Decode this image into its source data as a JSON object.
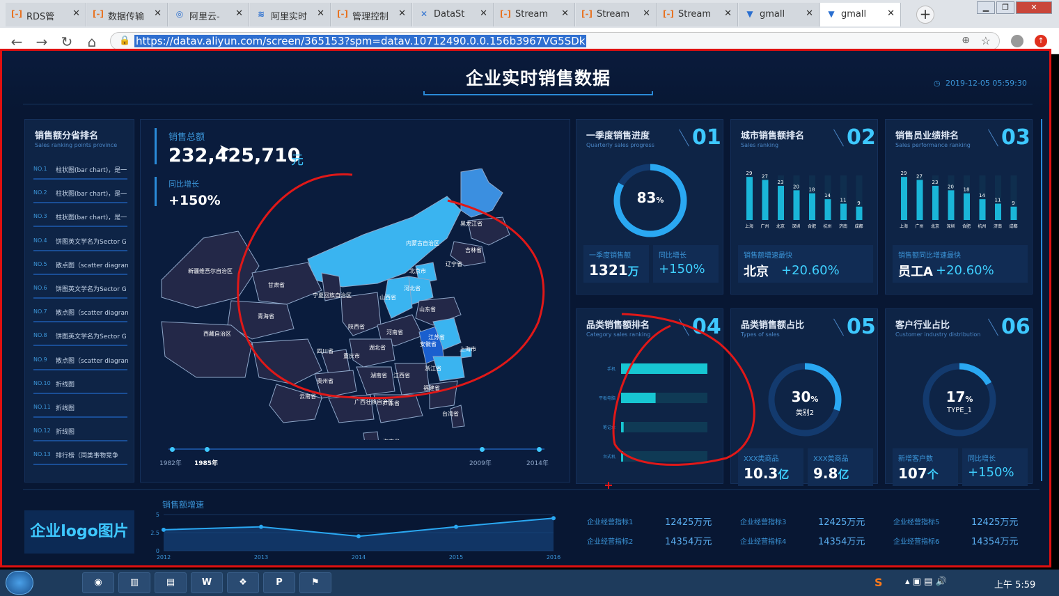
{
  "browser": {
    "tabs": [
      {
        "icon": "[-]",
        "label": "RDS管"
      },
      {
        "icon": "[-]",
        "label": "数据传输"
      },
      {
        "icon": "◎",
        "label": "阿里云-"
      },
      {
        "icon": "≋",
        "label": "阿里实时"
      },
      {
        "icon": "[-]",
        "label": "管理控制"
      },
      {
        "icon": "✕",
        "label": "DataSt"
      },
      {
        "icon": "[-]",
        "label": "Stream"
      },
      {
        "icon": "[-]",
        "label": "Stream"
      },
      {
        "icon": "[-]",
        "label": "Stream"
      },
      {
        "icon": "▼",
        "label": "gmall"
      },
      {
        "icon": "▼",
        "label": "gmall"
      }
    ],
    "url": "https://datav.aliyun.com/screen/365153?spm=datav.10712490.0.0.156b3967VG5SDk"
  },
  "dashboard": {
    "title": "企业实时销售数据",
    "timestamp": "2019-12-05 05:59:30",
    "left_panel": {
      "title": "销售额分省排名",
      "subtitle": "Sales ranking points province",
      "items": [
        {
          "no": "NO.1",
          "text": "柱状图(bar chart)，是一"
        },
        {
          "no": "NO.2",
          "text": "柱状图(bar chart)，是一"
        },
        {
          "no": "NO.3",
          "text": "柱状图(bar chart)，是一"
        },
        {
          "no": "NO.4",
          "text": "饼图英文学名为Sector G"
        },
        {
          "no": "NO.5",
          "text": "散点图（scatter diagran"
        },
        {
          "no": "NO.6",
          "text": "饼图英文学名为Sector G"
        },
        {
          "no": "NO.7",
          "text": "散点图（scatter diagran"
        },
        {
          "no": "NO.8",
          "text": "饼图英文学名为Sector G"
        },
        {
          "no": "NO.9",
          "text": "散点图（scatter diagran"
        },
        {
          "no": "NO.10",
          "text": "折线图"
        },
        {
          "no": "NO.11",
          "text": "折线图"
        },
        {
          "no": "NO.12",
          "text": "折线图"
        },
        {
          "no": "NO.13",
          "text": "排行榜（同类事物竞争"
        }
      ]
    },
    "map_panel": {
      "sales_label": "销售总额",
      "sales_value": "232,425,710",
      "sales_unit": "元",
      "growth_label": "同比增长",
      "growth_value": "+150%",
      "provinces": [
        "黑龙江省",
        "吉林省",
        "辽宁省",
        "内蒙古自治区",
        "北京市",
        "河北省",
        "山西省",
        "山东省",
        "新疆维吾尔自治区",
        "甘肃省",
        "青海省",
        "宁夏回族自治区",
        "陕西省",
        "河南省",
        "西藏自治区",
        "四川省",
        "重庆市",
        "湖北省",
        "安徽省",
        "江苏省",
        "上海市",
        "浙江省",
        "湖南省",
        "江西省",
        "福建省",
        "贵州省",
        "云南省",
        "广西壮族自治区",
        "广东省",
        "台湾省",
        "海南省"
      ],
      "timeline": [
        "1982年",
        "1985年",
        "2009年",
        "2014年"
      ]
    },
    "cards": [
      {
        "title": "一季度销售进度",
        "subtitle": "Quarterly sales progress",
        "num": "01",
        "gauge": "83",
        "gauge_unit": "%",
        "stat1_label": "一季度销售额",
        "stat1_value": "1321",
        "stat1_unit": "万",
        "stat2_label": "同比增长",
        "stat2_value": "+150%"
      },
      {
        "title": "城市销售额排名",
        "subtitle": "Sales ranking",
        "num": "02",
        "stat1_label": "销售额增速最快",
        "stat1_value": "北京",
        "stat2_value": "+20.60%"
      },
      {
        "title": "销售员业绩排名",
        "subtitle": "Sales performance ranking",
        "num": "03",
        "stat1_label": "销售额同比增速最快",
        "stat1_value": "员工A",
        "stat2_value": "+20.60%"
      },
      {
        "title": "品类销售额排名",
        "subtitle": "Category sales ranking",
        "num": "04"
      },
      {
        "title": "品类销售额占比",
        "subtitle": "Types of sales",
        "num": "05",
        "gauge": "30",
        "gauge_unit": "%",
        "gauge_label": "类别2",
        "stat1_label": "XXX类商品",
        "stat1_value": "10.3",
        "stat1_unit": "亿",
        "stat2_label": "XXX类商品",
        "stat2_value": "9.8",
        "stat2_unit": "亿"
      },
      {
        "title": "客户行业占比",
        "subtitle": "Customer industry distribution",
        "num": "06",
        "gauge": "17",
        "gauge_unit": "%",
        "gauge_label": "TYPE_1",
        "stat1_label": "新增客户数",
        "stat1_value": "107",
        "stat1_unit": "个",
        "stat2_label": "同比增长",
        "stat2_value": "+150%"
      }
    ],
    "logo_text": "企业logo图片",
    "growth_chart_title": "销售额增速",
    "metrics": [
      {
        "label": "企业经营指标1",
        "value": "12425万元"
      },
      {
        "label": "企业经营指标2",
        "value": "14354万元"
      },
      {
        "label": "企业经营指标3",
        "value": "12425万元"
      },
      {
        "label": "企业经营指标4",
        "value": "14354万元"
      },
      {
        "label": "企业经营指标5",
        "value": "12425万元"
      },
      {
        "label": "企业经营指标6",
        "value": "14354万元"
      }
    ]
  },
  "chart_data": [
    {
      "type": "bar",
      "categories": [
        "上海",
        "广州",
        "北京",
        "深圳",
        "合肥",
        "杭州",
        "济南",
        "成都"
      ],
      "values": [
        29,
        27,
        23,
        20,
        18,
        14,
        11,
        9
      ],
      "ylim": [
        0,
        30
      ]
    },
    {
      "type": "bar",
      "categories": [
        "上海",
        "广州",
        "北京",
        "深圳",
        "合肥",
        "杭州",
        "济南",
        "成都"
      ],
      "values": [
        29,
        27,
        23,
        20,
        18,
        14,
        11,
        9
      ],
      "ylim": [
        0,
        30
      ]
    },
    {
      "type": "bar",
      "orientation": "horizontal",
      "categories": [
        "手机",
        "平板电脑",
        "笔记本",
        "台式机"
      ],
      "values": [
        100,
        40,
        3,
        2
      ],
      "ylim": [
        0,
        100
      ]
    },
    {
      "type": "line",
      "title": "销售额增速",
      "x": [
        "2012",
        "2013",
        "2014",
        "2015",
        "2016"
      ],
      "values": [
        2.9,
        3.3,
        2.0,
        3.3,
        4.5
      ],
      "ylim": [
        0,
        5
      ],
      "yticks": [
        "0",
        "2.5",
        "5"
      ]
    }
  ],
  "taskbar": {
    "clock": "上午 5:59",
    "apps": [
      "◉",
      "▥",
      "▤",
      "W",
      "❖",
      "P",
      "⚑"
    ]
  }
}
